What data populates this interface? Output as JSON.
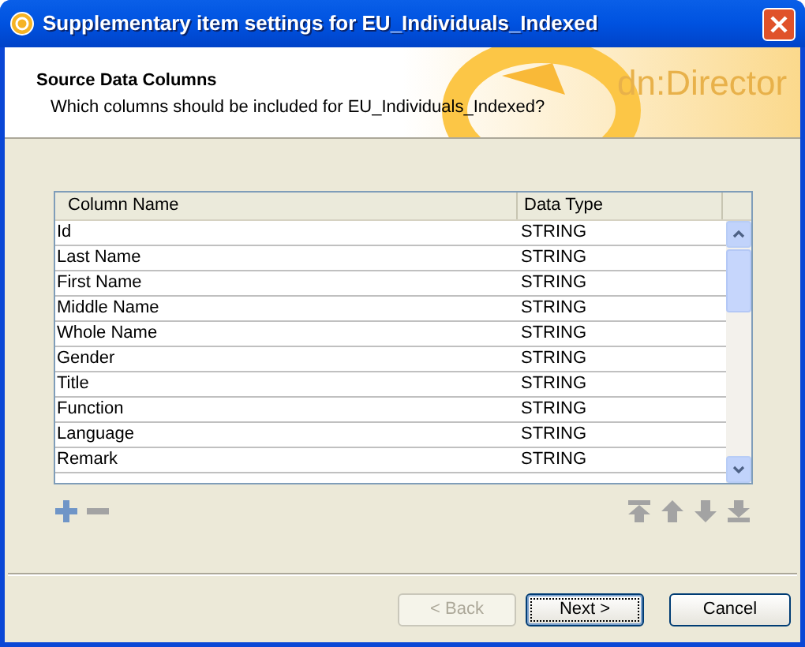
{
  "window": {
    "title": "Supplementary item settings for EU_Individuals_Indexed"
  },
  "header": {
    "title": "Source Data Columns",
    "subtitle": "Which columns should be included for EU_Individuals_Indexed?",
    "logo_text": "dn:Director"
  },
  "table": {
    "columns": [
      "Column Name",
      "Data Type"
    ],
    "rows": [
      [
        "Id",
        "STRING"
      ],
      [
        "Last Name",
        "STRING"
      ],
      [
        "First Name",
        "STRING"
      ],
      [
        "Middle Name",
        "STRING"
      ],
      [
        "Whole Name",
        "STRING"
      ],
      [
        "Gender",
        "STRING"
      ],
      [
        "Title",
        "STRING"
      ],
      [
        "Function",
        "STRING"
      ],
      [
        "Language",
        "STRING"
      ],
      [
        "Remark",
        "STRING"
      ]
    ]
  },
  "row_tools": [
    {
      "kind": "add",
      "disabled": false
    },
    {
      "kind": "remove",
      "disabled": true
    }
  ],
  "move_tools": [
    {
      "kind": "top",
      "disabled": true
    },
    {
      "kind": "up",
      "disabled": true
    },
    {
      "kind": "down",
      "disabled": true
    },
    {
      "kind": "bottom",
      "disabled": true
    }
  ],
  "buttons": [
    {
      "label": "< Back",
      "disabled": true,
      "focused": false
    },
    {
      "label": "Next >",
      "disabled": false,
      "focused": true
    },
    {
      "label": "Cancel",
      "disabled": false,
      "focused": false
    }
  ]
}
